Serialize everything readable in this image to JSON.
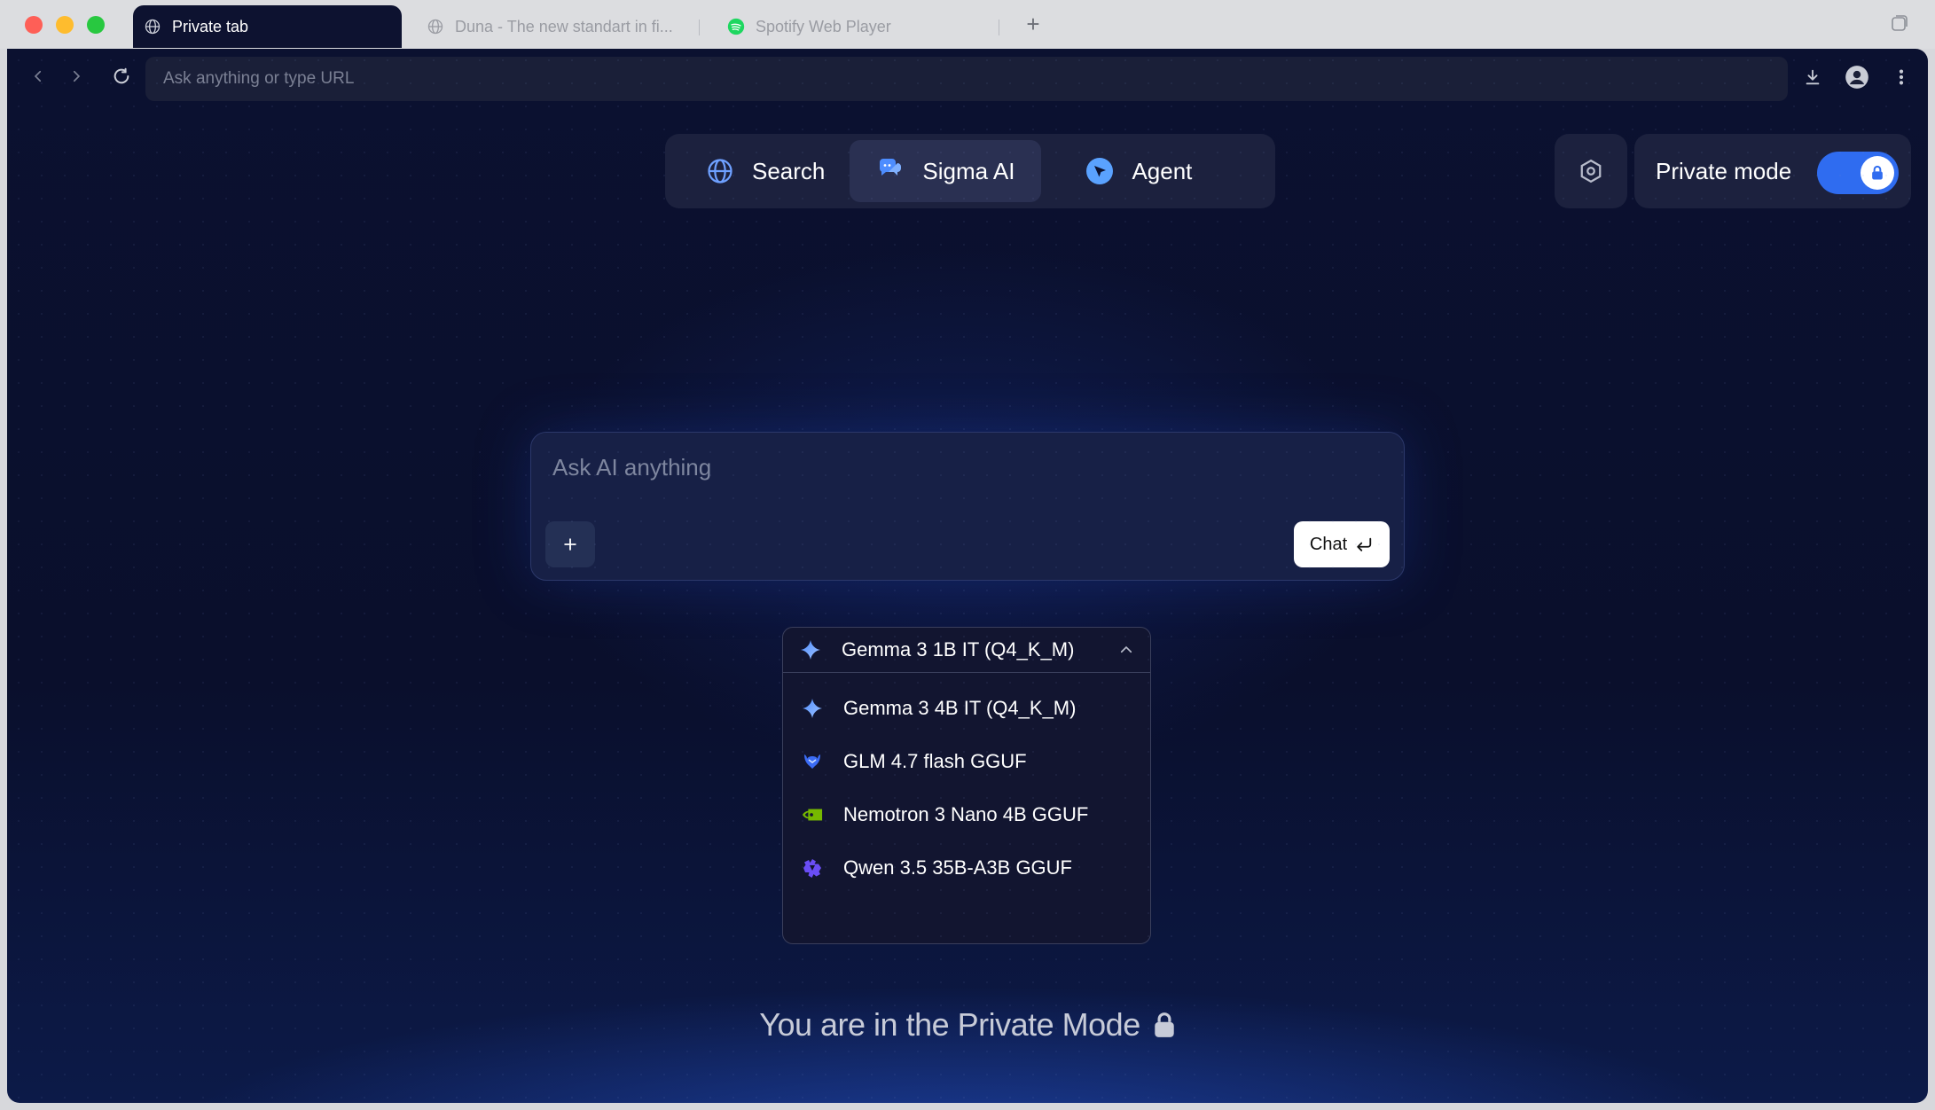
{
  "tabs": [
    {
      "title": "Private tab",
      "icon": "globe-icon",
      "active": true
    },
    {
      "title": "Duna - The new standart in fi...",
      "icon": "globe-icon",
      "active": false
    },
    {
      "title": "Spotify Web Player",
      "icon": "spotify-icon",
      "active": false
    }
  ],
  "new_tab_label": "+",
  "address_bar": {
    "placeholder": "Ask anything or type URL",
    "value": ""
  },
  "modes": [
    {
      "label": "Search",
      "icon": "globe-icon"
    },
    {
      "label": "Sigma AI",
      "icon": "chat-bubbles-icon",
      "selected": true
    },
    {
      "label": "Agent",
      "icon": "agent-cursor-icon"
    }
  ],
  "private_mode": {
    "label": "Private mode",
    "enabled": true
  },
  "chat": {
    "placeholder": "Ask AI anything",
    "value": "",
    "submit_label": "Chat"
  },
  "model_selector": {
    "selected": "Gemma 3 1B IT (Q4_K_M)",
    "selected_icon": "gemma-sparkle-icon",
    "options": [
      {
        "label": "Gemma 3 4B IT (Q4_K_M)",
        "icon": "gemma-sparkle-icon"
      },
      {
        "label": "GLM 4.7 flash GGUF",
        "icon": "glm-icon"
      },
      {
        "label": "Nemotron 3 Nano 4B GGUF",
        "icon": "nvidia-icon"
      },
      {
        "label": "Qwen 3.5 35B-A3B GGUF",
        "icon": "qwen-icon"
      }
    ]
  },
  "footer_message": "You are in the Private Mode",
  "colors": {
    "accent": "#2f6cf0",
    "background": "#0b1130",
    "panel": "#1e2440",
    "text": "#ffffff"
  }
}
